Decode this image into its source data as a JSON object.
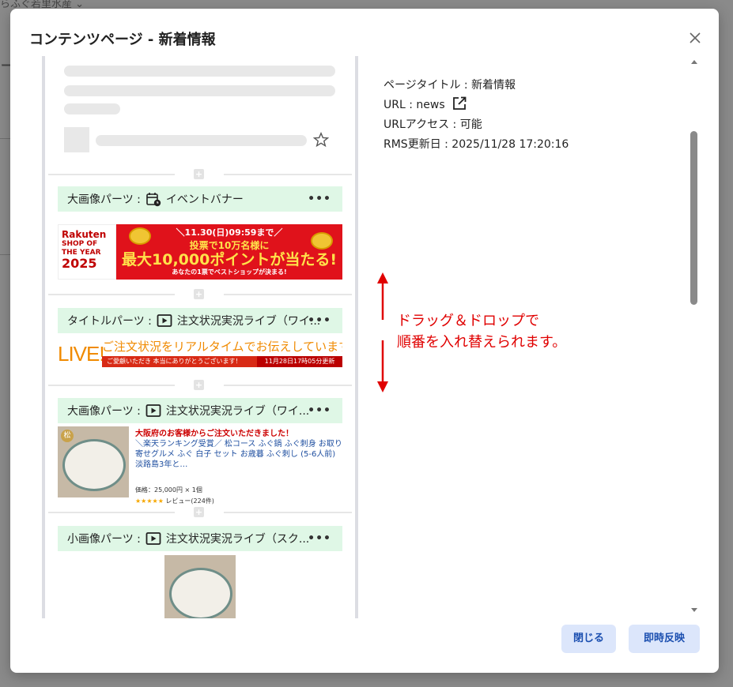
{
  "background": {
    "crumb": "らふぐ若里水産 ⌄"
  },
  "modal": {
    "title": "コンテンツページ - 新着情報",
    "close_icon": "close-icon"
  },
  "parts": [
    {
      "label": "大画像パーツ :",
      "icon": "calendar-clock-icon",
      "name": "イベントバナー",
      "more": "•••"
    },
    {
      "label": "タイトルパーツ :",
      "icon": "play-video-icon",
      "name": "注文状況実況ライブ（ワイ...",
      "more": "•••"
    },
    {
      "label": "大画像パーツ :",
      "icon": "play-video-icon",
      "name": "注文状況実況ライブ（ワイ...",
      "more": "•••"
    },
    {
      "label": "小画像パーツ :",
      "icon": "play-video-icon",
      "name": "注文状況実況ライブ（スク...",
      "more": "•••"
    }
  ],
  "sale_banner": {
    "brand": "Rakuten",
    "shop_line1": "SHOP OF",
    "shop_line2": "THE YEAR",
    "year": "2025",
    "line1": "＼11.30(日)09:59まで／",
    "line2": "投票で10万名様に",
    "line3": "最大10,000ポイントが当たる!",
    "line4": "あなたの1票でベストショップが決まる!"
  },
  "live_banner": {
    "live": "LIVE!",
    "headline": "ご注文状況をリアルタイムでお伝えしています",
    "thanks": "ご愛顧いただき 本当にありがとうございます！",
    "updated": "11月28日17時05分更新"
  },
  "product": {
    "title": "大阪府のお客様からご注文いただきました！",
    "description": "＼楽天ランキング受賞／ 松コース ふぐ鍋 ふぐ刺身 お取り寄せグルメ ふぐ 白子 セット お歳暮 ふぐ刺し (5-6人前) 淡路島3年と…",
    "price": "価格：25,000円 × 1個",
    "stars": "★★★★★",
    "review": "レビュー(224件)",
    "badge": "松"
  },
  "info": {
    "page_title": "ページタイトル : 新着情報",
    "url": "URL : news",
    "url_access": "URLアクセス : 可能",
    "rms_updated": "RMS更新日 : 2025/11/28 17:20:16",
    "external_icon": "external-link-icon"
  },
  "annotation": {
    "line1": "ドラッグ＆ドロップで",
    "line2": "順番を入れ替えられます。"
  },
  "buttons": {
    "close": "閉じる",
    "apply": "即時反映"
  },
  "colors": {
    "part_header_bg": "#dff7e6",
    "button_bg": "#dce6fb",
    "button_text": "#1b4fb0",
    "annotation": "#e00000"
  }
}
